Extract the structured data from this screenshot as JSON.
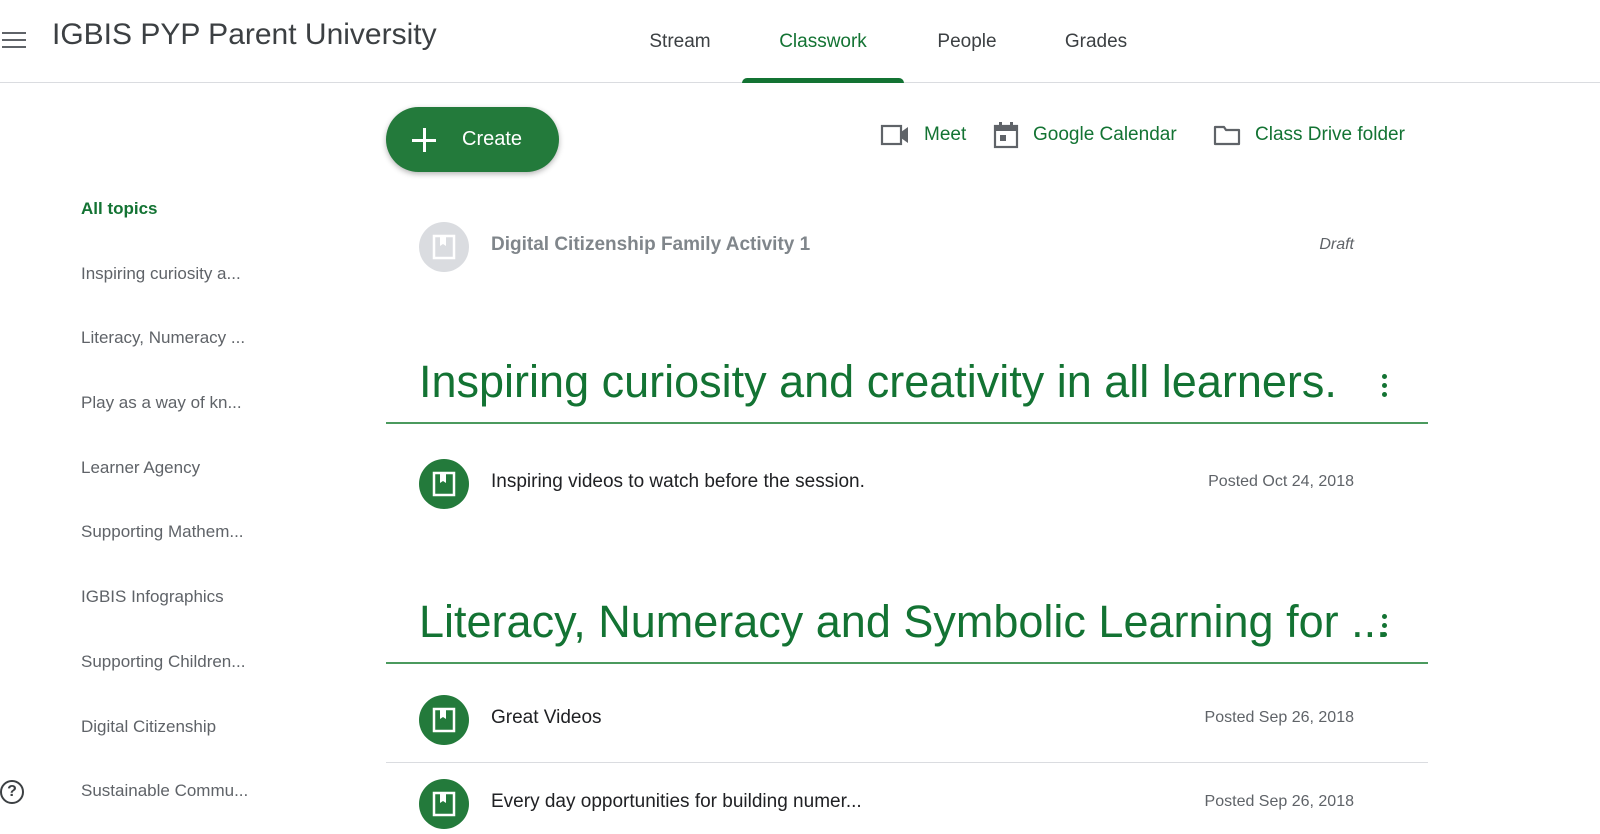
{
  "header": {
    "class_title": "IGBIS PYP Parent University",
    "tabs": [
      {
        "label": "Stream"
      },
      {
        "label": "Classwork"
      },
      {
        "label": "People"
      },
      {
        "label": "Grades"
      }
    ]
  },
  "toolbar": {
    "create_label": "Create",
    "meet_label": "Meet",
    "calendar_label": "Google Calendar",
    "drive_label": "Class Drive folder"
  },
  "sidebar": {
    "items": [
      {
        "label": "All topics"
      },
      {
        "label": "Inspiring curiosity a..."
      },
      {
        "label": "Literacy, Numeracy ..."
      },
      {
        "label": "Play as a way of kn..."
      },
      {
        "label": "Learner Agency"
      },
      {
        "label": "Supporting Mathem..."
      },
      {
        "label": "IGBIS Infographics"
      },
      {
        "label": "Supporting Children..."
      },
      {
        "label": "Digital Citizenship"
      },
      {
        "label": "Sustainable Commu..."
      }
    ],
    "help_glyph": "?"
  },
  "content": {
    "draft_item": {
      "title": "Digital Citizenship Family Activity 1",
      "meta": "Draft"
    },
    "topics": [
      {
        "title": "Inspiring curiosity and creativity in all learners.",
        "items": [
          {
            "title": "Inspiring videos to watch before the session.",
            "meta": "Posted Oct 24, 2018"
          }
        ]
      },
      {
        "title": "Literacy, Numeracy and Symbolic Learning for ...",
        "items": [
          {
            "title": "Great Videos",
            "meta": "Posted Sep 26, 2018"
          },
          {
            "title": "Every day opportunities for building numer...",
            "meta": "Posted Sep 26, 2018"
          }
        ]
      }
    ]
  },
  "colors": {
    "accent": "#137333",
    "accent_fill": "#237a3b",
    "muted_text": "#5f6368",
    "divider": "#dadce0"
  },
  "icons": {
    "menu": "hamburger-menu-icon",
    "create": "plus-icon",
    "meet": "video-camera-icon",
    "calendar": "calendar-icon",
    "drive": "folder-icon",
    "assignment": "material-icon",
    "more": "more-vert-icon",
    "help": "help-icon"
  }
}
